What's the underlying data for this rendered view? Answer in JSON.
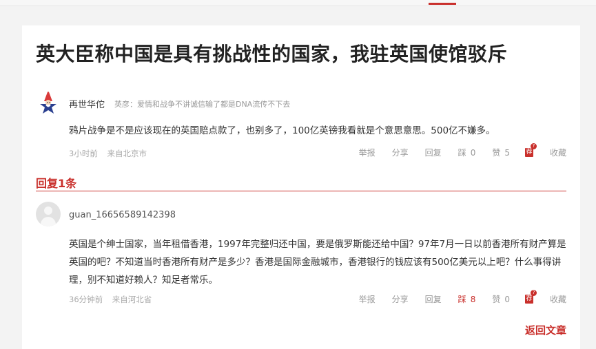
{
  "article": {
    "title": "英大臣称中国是具有挑战性的国家，我驻英国使馆驳斥"
  },
  "comment": {
    "username": "再世华佗",
    "signature": "英彦：爱情和战争不讲诚信输了都是DNA流传不下去",
    "text": "鸦片战争是不是应该现在的英国赔点款了，也别多了，100亿英镑我看就是个意思意思。500亿不嫌多。",
    "time": "3小时前",
    "location": "来自北京市",
    "actions": {
      "report": "举报",
      "share": "分享",
      "reply": "回复",
      "down_label": "踩",
      "down_count": "0",
      "up_label": "赞",
      "up_count": "5",
      "recommend": "荐",
      "recommend_badge": "?",
      "collect": "收藏"
    }
  },
  "replies": {
    "header": "回复1条",
    "items": [
      {
        "username": "guan_16656589142398",
        "text": "英国是个绅士国家，当年租借香港，1997年完整归还中国，要是俄罗斯能还给中国？97年7月一日以前香港所有财产算是英国的吧？不知道当时香港所有财产是多少？香港是国际金融城市，香港银行的钱应该有500亿美元以上吧？什么事得讲理，别不知道好赖人？知足者常乐。",
        "time": "36分钟前",
        "location": "来自河北省",
        "actions": {
          "report": "举报",
          "share": "分享",
          "reply": "回复",
          "down_label": "踩",
          "down_count": "8",
          "up_label": "赞",
          "up_count": "0",
          "recommend": "荐",
          "recommend_badge": "?",
          "collect": "收藏"
        }
      }
    ]
  },
  "footer": {
    "back_link": "返回文章"
  },
  "colors": {
    "accent": "#c9302c",
    "background": "#f3f3f3",
    "card": "#ffffff"
  },
  "icons": {
    "main_avatar": "wizard-star-avatar-icon",
    "reply_avatar": "default-user-avatar-icon",
    "recommend": "recommend-badge-icon"
  }
}
